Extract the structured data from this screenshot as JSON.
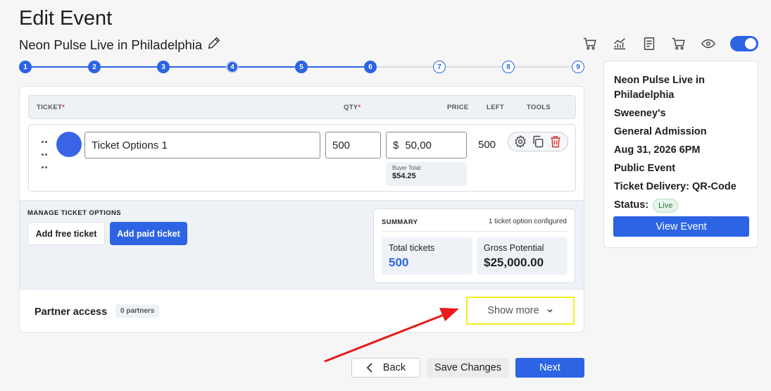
{
  "header": {
    "title": "Edit Event",
    "event_name": "Neon Pulse Live in Philadelphia"
  },
  "toolbar": {
    "icons": [
      "cart-icon",
      "chart-icon",
      "clipboard-icon",
      "cart-icon",
      "eye-icon"
    ],
    "toggle_on": true
  },
  "stepper": {
    "steps": [
      "1",
      "2",
      "3",
      "4",
      "5",
      "6",
      "7",
      "8",
      "9"
    ],
    "completed": 6
  },
  "ticket_table": {
    "headers": {
      "ticket": "TICKET",
      "qty": "QTY",
      "price": "PRICE",
      "left": "LEFT",
      "tools": "TOOLS"
    },
    "required_mark": "*",
    "row": {
      "name": "Ticket Options 1",
      "qty": "500",
      "currency": "$",
      "price": "50,00",
      "buyer_total_label": "Buyer Total:",
      "buyer_total": "$54.25",
      "left": "500",
      "color": "#3a64e6"
    }
  },
  "manage": {
    "title": "MANAGE TICKET OPTIONS",
    "add_free": "Add free ticket",
    "add_paid": "Add paid ticket"
  },
  "summary": {
    "title": "SUMMARY",
    "note": "1 ticket option configured",
    "total_label": "Total tickets",
    "total_value": "500",
    "gross_label": "Gross Potential",
    "gross_value": "$25,000.00"
  },
  "partner": {
    "label": "Partner access",
    "badge": "0 partners",
    "show_more": "Show more"
  },
  "info": {
    "name": "Neon Pulse Live in Philadelphia",
    "venue": "Sweeney's",
    "admission": "General Admission",
    "date": "Aug 31, 2026 6PM",
    "visibility": "Public Event",
    "delivery": "Ticket Delivery: QR-Code",
    "status_label": "Status:",
    "status_value": "Live",
    "view_button": "View Event"
  },
  "footer": {
    "back": "Back",
    "save": "Save Changes",
    "next": "Next"
  },
  "colors": {
    "primary": "#2c64e3",
    "highlight": "#f5ef1d",
    "annotation": "#e81a1a"
  }
}
